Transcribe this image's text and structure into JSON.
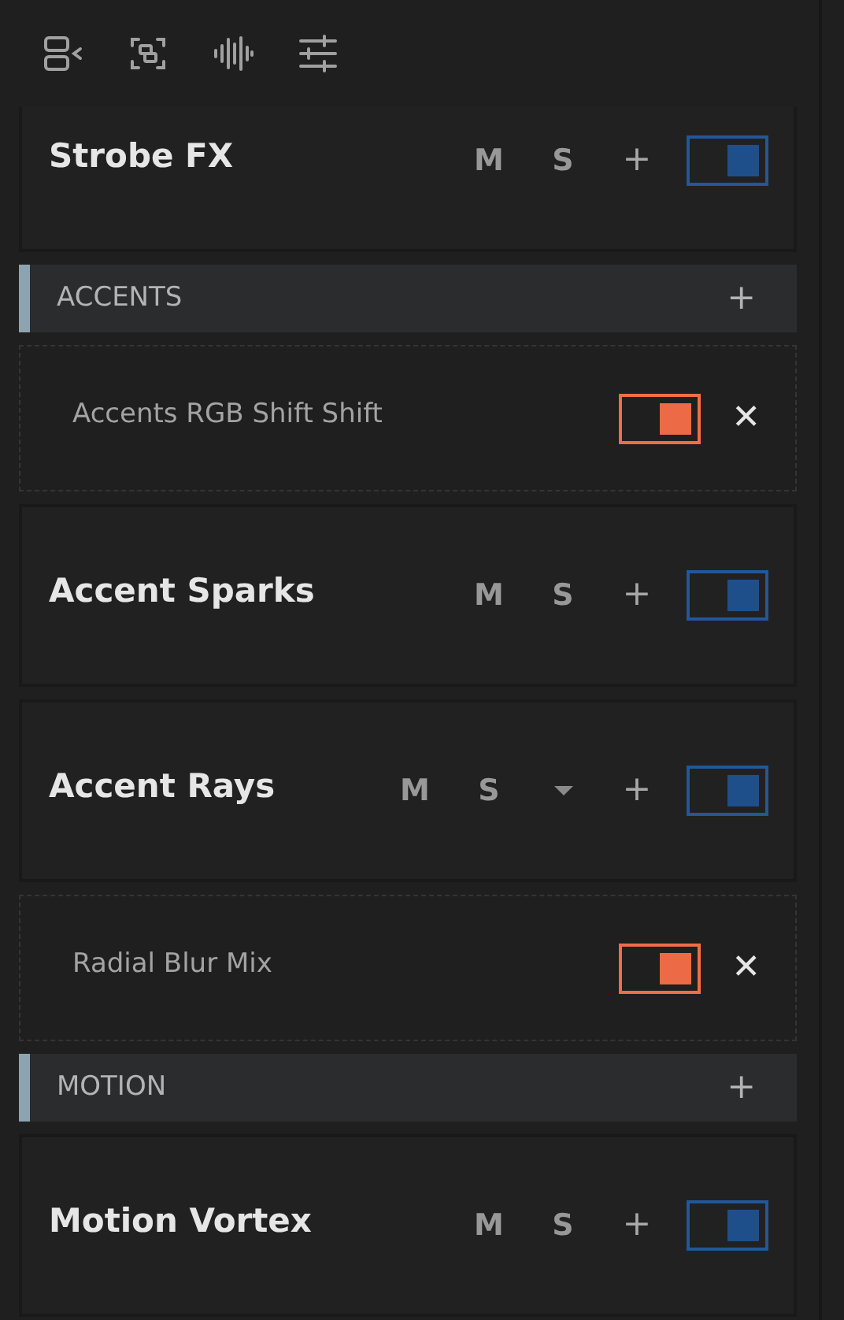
{
  "rows": [
    {
      "kind": "layer",
      "title": "Strobe FX",
      "buttons": [
        "M",
        "S"
      ],
      "menu": false,
      "add": "+",
      "on": true
    },
    {
      "kind": "section",
      "label": "ACCENTS",
      "add": "+"
    },
    {
      "kind": "effect",
      "title": "Accents RGB Shift Shift",
      "on": true,
      "remove": "✕"
    },
    {
      "kind": "layer",
      "title": "Accent Sparks",
      "buttons": [
        "M",
        "S"
      ],
      "menu": false,
      "add": "+",
      "on": true
    },
    {
      "kind": "layer",
      "title": "Accent Rays",
      "buttons": [
        "M",
        "S"
      ],
      "menu": true,
      "add": "+",
      "on": true
    },
    {
      "kind": "effect",
      "title": "Radial Blur Mix",
      "on": true,
      "remove": "✕"
    },
    {
      "kind": "section",
      "label": "MOTION",
      "add": "+"
    },
    {
      "kind": "layer",
      "title": "Motion Vortex",
      "buttons": [
        "M",
        "S"
      ],
      "menu": false,
      "add": "+",
      "on": true
    }
  ]
}
